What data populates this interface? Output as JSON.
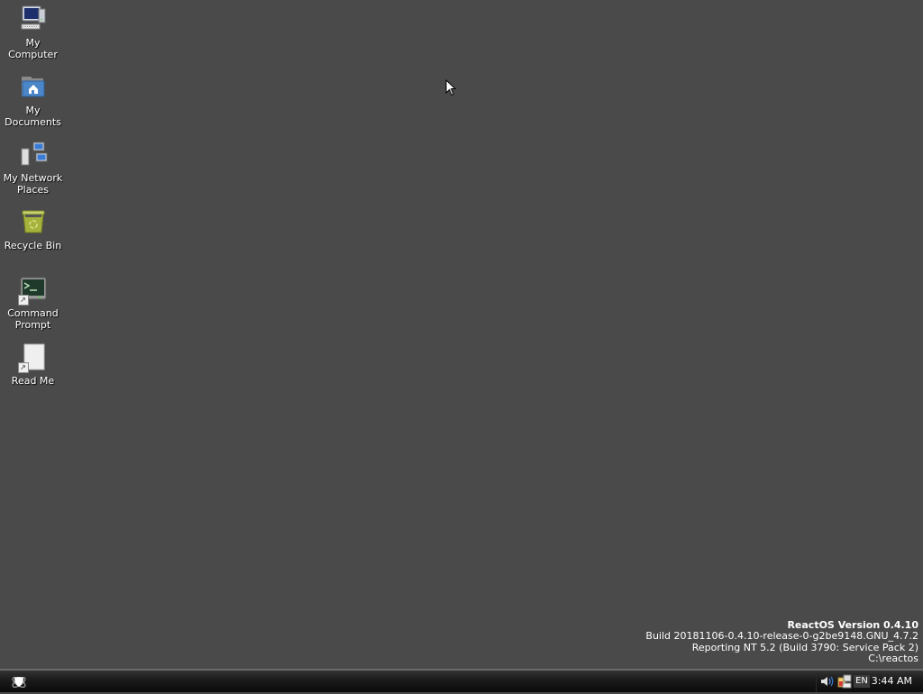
{
  "desktop": {
    "background_color": "#4a4a4a",
    "icons": [
      {
        "label_line1": "My",
        "label_line2": "Computer",
        "icon": "computer-icon"
      },
      {
        "label_line1": "My",
        "label_line2": "Documents",
        "icon": "documents-folder-icon"
      },
      {
        "label_line1": "My Network",
        "label_line2": "Places",
        "icon": "network-places-icon"
      },
      {
        "label_line1": "Recycle Bin",
        "label_line2": "",
        "icon": "recycle-bin-icon"
      },
      {
        "label_line1": "Command",
        "label_line2": "Prompt",
        "icon": "command-prompt-icon"
      },
      {
        "label_line1": "Read Me",
        "label_line2": "",
        "icon": "readme-document-icon"
      }
    ]
  },
  "version_info": {
    "title": "ReactOS Version 0.4.10",
    "build": "Build 20181106-0.4.10-release-0-g2be9148.GNU_4.7.2",
    "reporting": "Reporting NT 5.2 (Build 3790: Service Pack 2)",
    "path": "C:\\reactos"
  },
  "taskbar": {
    "start_icon": "reactos-start-icon",
    "tray": {
      "volume_icon": "speaker-volume-icon",
      "network_icon": "network-tray-icon",
      "language": "EN",
      "clock": "3:44 AM"
    }
  }
}
